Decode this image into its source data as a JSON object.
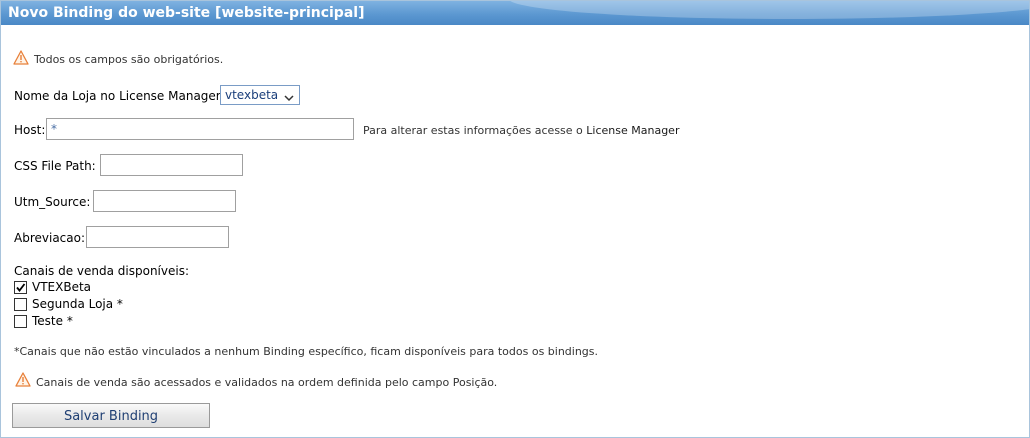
{
  "window": {
    "title": "Novo Binding do web-site [website-principal]"
  },
  "notices": {
    "required": "Todos os campos são obrigatórios.",
    "channels_footnote": "*Canais que não estão vinculados a nenhum Binding específico, ficam disponíveis para todos os bindings.",
    "order_warning": "Canais de venda são acessados e validados na ordem definida pelo campo Posição."
  },
  "form": {
    "store_label": "Nome da Loja no License Manager:",
    "store_selected": "vtexbeta",
    "host_label": "Host:",
    "host_value": "*",
    "host_hint_prefix": "Para alterar estas informações acesse o ",
    "host_hint_link": "License Manager",
    "css_label": "CSS File Path:",
    "css_value": "",
    "utm_label": "Utm_Source:",
    "utm_value": "",
    "abbrev_label": "Abreviacao:",
    "abbrev_value": ""
  },
  "channels": {
    "label": "Canais de venda disponíveis:",
    "items": [
      {
        "label": "VTEXBeta",
        "checked": true
      },
      {
        "label": "Segunda Loja *",
        "checked": false
      },
      {
        "label": "Teste *",
        "checked": false
      }
    ]
  },
  "actions": {
    "save_label": "Salvar Binding"
  },
  "icons": {
    "warning": "warning-triangle-icon",
    "dropdown": "chevron-down-icon",
    "check": "checkmark-icon"
  },
  "colors": {
    "title_bar": "#5c98d1",
    "warning": "#e8803a",
    "button_text": "#1f3f73"
  }
}
